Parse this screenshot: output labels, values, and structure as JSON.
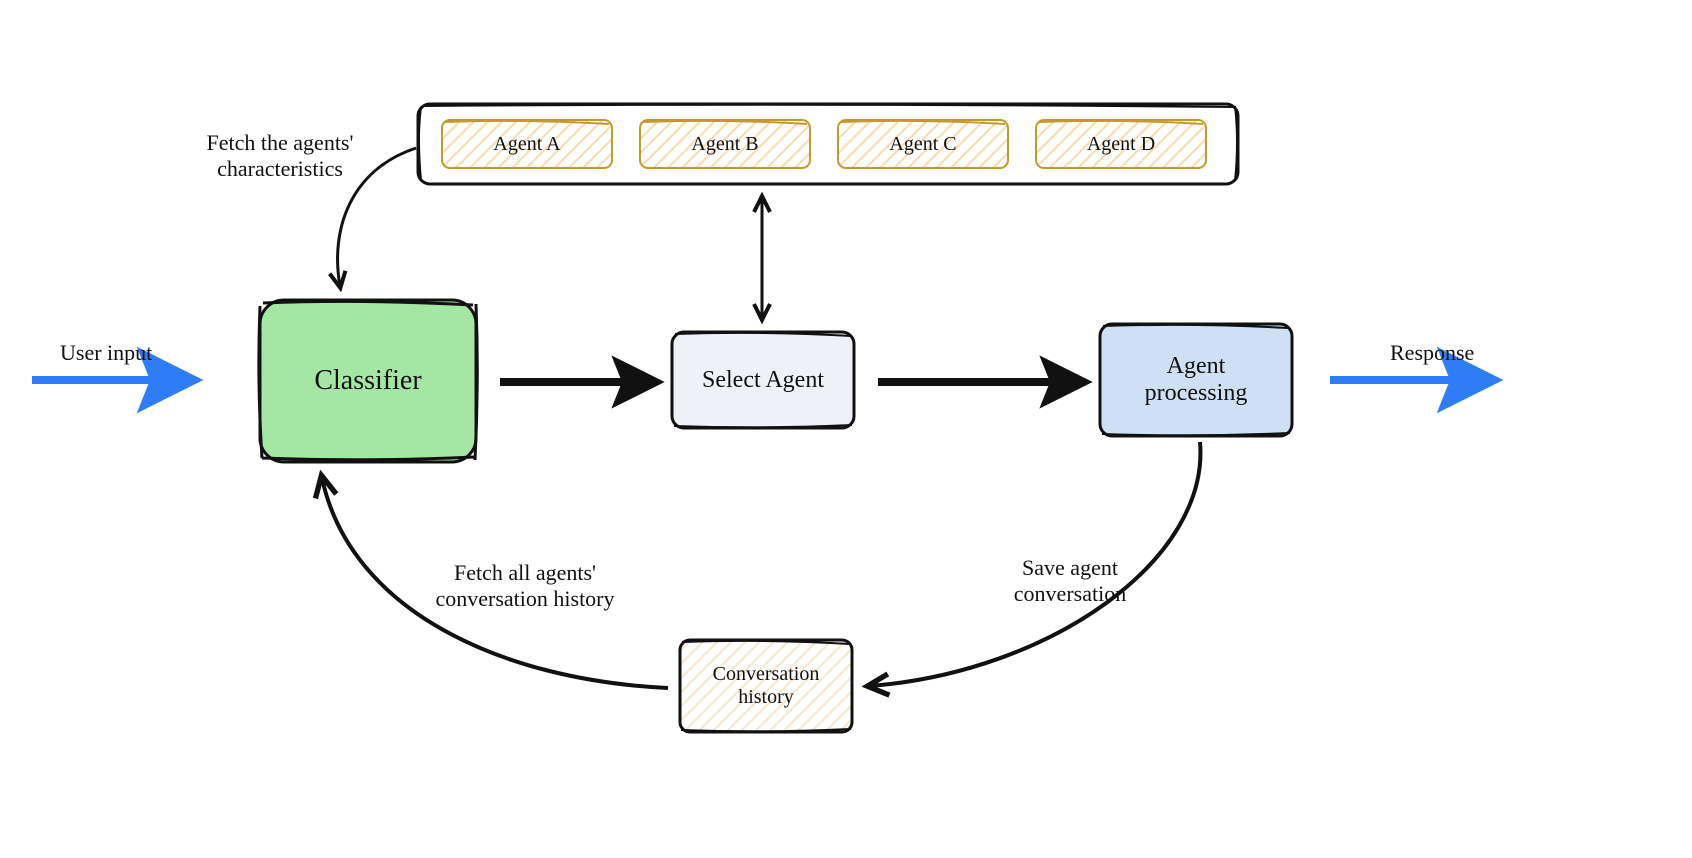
{
  "labels": {
    "user_input": "User input",
    "response": "Response",
    "fetch_characteristics": "Fetch the agents'\ncharacteristics",
    "fetch_history": "Fetch all agents'\nconversation history",
    "save_conversation": "Save agent\nconversation"
  },
  "nodes": {
    "classifier": "Classifier",
    "select_agent": "Select Agent",
    "agent_processing": "Agent\nprocessing",
    "conversation_history": "Conversation\nhistory"
  },
  "agents_container": {
    "items": [
      "Agent A",
      "Agent B",
      "Agent C",
      "Agent D"
    ]
  },
  "colors": {
    "blue_arrow": "#2f7df6",
    "green_fill": "#a6e6a4",
    "select_fill": "#eef2f8",
    "agentproc_fill": "#cfe0f5",
    "convhist_fill": "#f8f0dd",
    "agent_border": "#c59a2a",
    "agent_hatch": "#f4dcb0"
  }
}
